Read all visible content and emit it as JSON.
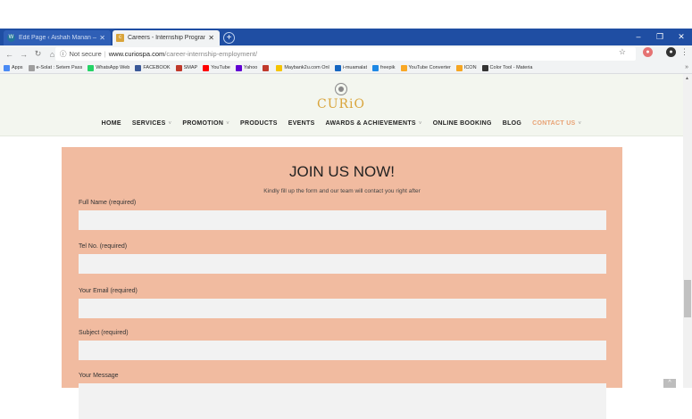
{
  "browser": {
    "tabs": [
      {
        "title": "Edit Page ‹ Aishah Manan — Wo",
        "active": false
      },
      {
        "title": "Careers - Internship Programme",
        "active": true
      }
    ],
    "new_tab": "+",
    "url": {
      "security": "Not secure",
      "host": "www.curiospa.com",
      "path": "/career-internship-employment/"
    },
    "window_controls": {
      "minimize": "–",
      "maximize": "❐",
      "close": "✕"
    }
  },
  "bookmarks": [
    {
      "label": "Apps",
      "color": "#4a8af4"
    },
    {
      "label": "e-Solat : Setem Pass",
      "color": "#9e9e9e"
    },
    {
      "label": "WhatsApp Web",
      "color": "#25d366"
    },
    {
      "label": "FACEBOOK",
      "color": "#3b5998"
    },
    {
      "label": "SMAP",
      "color": "#c0392b"
    },
    {
      "label": "YouTube",
      "color": "#ff0000"
    },
    {
      "label": "Yahoo",
      "color": "#6001d2"
    },
    {
      "label": "",
      "color": "#c0392b"
    },
    {
      "label": "Maybank2u.com Onl",
      "color": "#f5c400"
    },
    {
      "label": "i-muamalat",
      "color": "#1565c0"
    },
    {
      "label": "freepik",
      "color": "#1e88e5"
    },
    {
      "label": "YouTube Converter",
      "color": "#f9a825"
    },
    {
      "label": "ICON",
      "color": "#f5a623"
    },
    {
      "label": "Color Tool - Materia",
      "color": "#333333"
    }
  ],
  "site": {
    "logo": "CURiO",
    "nav": [
      {
        "label": "HOME",
        "dropdown": false
      },
      {
        "label": "SERVICES",
        "dropdown": true
      },
      {
        "label": "PROMOTION",
        "dropdown": true
      },
      {
        "label": "PRODUCTS",
        "dropdown": false
      },
      {
        "label": "EVENTS",
        "dropdown": false
      },
      {
        "label": "AWARDS & ACHIEVEMENTS",
        "dropdown": true
      },
      {
        "label": "ONLINE BOOKING",
        "dropdown": false
      },
      {
        "label": "BLOG",
        "dropdown": false
      },
      {
        "label": "CONTACT US",
        "dropdown": true,
        "active": true
      }
    ]
  },
  "form": {
    "title": "JOIN US NOW!",
    "subtitle": "Kindly fill up the form and our team will contact you right after",
    "fields": [
      {
        "label": "Full Name (required)",
        "value": ""
      },
      {
        "label": "Tel No. (required)",
        "value": ""
      },
      {
        "label": "Your Email (required)",
        "value": ""
      },
      {
        "label": "Subject (required)",
        "value": ""
      },
      {
        "label": "Your Message",
        "value": ""
      }
    ]
  },
  "colors": {
    "panel": "#f1bba0",
    "accent": "#e8a173",
    "logo": "#d9a43a",
    "tabstrip": "#1f4ea3"
  }
}
